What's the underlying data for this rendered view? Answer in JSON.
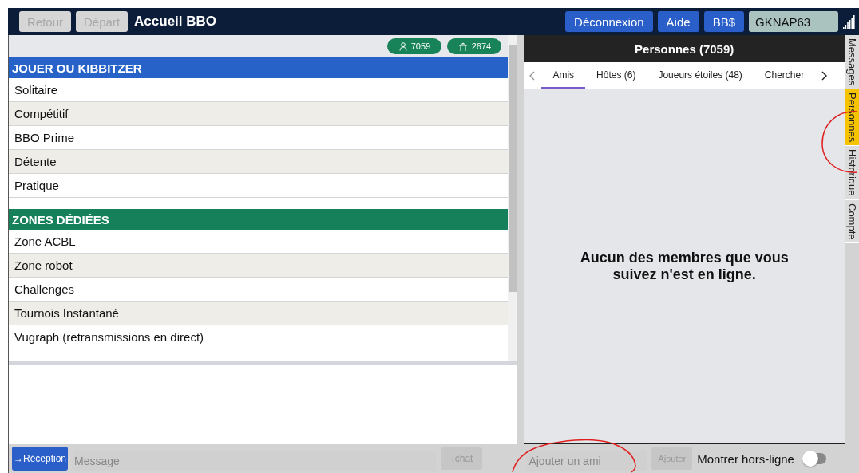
{
  "topbar": {
    "buttons": [
      {
        "label": "Retour",
        "disabled": true
      },
      {
        "label": "Départ",
        "disabled": true
      }
    ],
    "title": "Accueil BBO",
    "actions": [
      {
        "label": "Déconnexion"
      },
      {
        "label": "Aide"
      },
      {
        "label": "BB$"
      }
    ],
    "username": "GKNAP63"
  },
  "stats": [
    {
      "kind": "people",
      "value": "7059"
    },
    {
      "kind": "tables",
      "value": "2674"
    }
  ],
  "sections": [
    {
      "title": "JOUER OU KIBBITZER",
      "color": "#2762c9",
      "items": [
        "Solitaire",
        "Compétitif",
        "BBO Prime",
        "Détente",
        "Pratique"
      ]
    },
    {
      "title": "ZONES DÉDIÉES",
      "color": "#15805a",
      "items": [
        "Zone ACBL",
        "Zone robot",
        "Challenges",
        "Tournois Instantané",
        "Vugraph (retransmissions en direct)"
      ]
    }
  ],
  "chat": {
    "channel": "→Réception",
    "placeholder": "Message",
    "send": "Tchat"
  },
  "people": {
    "title": "Personnes (7059)",
    "tabs": [
      {
        "label": "Amis",
        "selected": true
      },
      {
        "label": "Hôtes (6)",
        "selected": false
      },
      {
        "label": "Joueurs étoiles (48)",
        "selected": false
      },
      {
        "label": "Chercher",
        "selected": false
      }
    ],
    "empty": "Aucun des membres que vous suivez n'est en ligne.",
    "add_placeholder": "Ajouter un ami",
    "add_button": "Ajouter",
    "offline_label": "Montrer hors-ligne",
    "offline_on": false
  },
  "side_tabs": [
    {
      "label": "Messages",
      "selected": false
    },
    {
      "label": "Personnes",
      "selected": true
    },
    {
      "label": "Historique",
      "selected": false
    },
    {
      "label": "Compte",
      "selected": false
    }
  ]
}
